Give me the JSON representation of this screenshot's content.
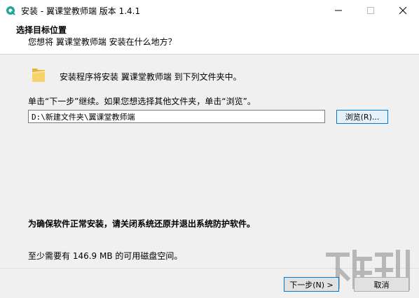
{
  "window": {
    "title": "安装 - 翼课堂教师端 版本 1.4.1",
    "controls": {
      "minimize_icon": "minimize-icon",
      "maximize_icon": "maximize-icon",
      "close_icon": "close-icon"
    }
  },
  "header": {
    "title": "选择目标位置",
    "subtitle": "您想将 翼课堂教师端 安装在什么地方？"
  },
  "body": {
    "intro": "安装程序将安装 翼课堂教师端 到下列文件夹中。",
    "instruction": "单击“下一步”继续。如果您想选择其他文件夹，单击“浏览”。",
    "path_value": "D:\\新建文件夹\\翼课堂教师端",
    "browse_label": "浏览(R)...",
    "warning": "为确保软件正常安装，请关闭系统还原并退出系统防护软件。",
    "space_required": "至少需要有 146.9 MB 的可用磁盘空间。"
  },
  "footer": {
    "next_label": "下一步(N) >",
    "cancel_label": "取消"
  },
  "colors": {
    "accent": "#0078d7",
    "app_icon": "#1fa89a",
    "folder": "#f0c75e",
    "watermark": "#8a8a8a"
  }
}
